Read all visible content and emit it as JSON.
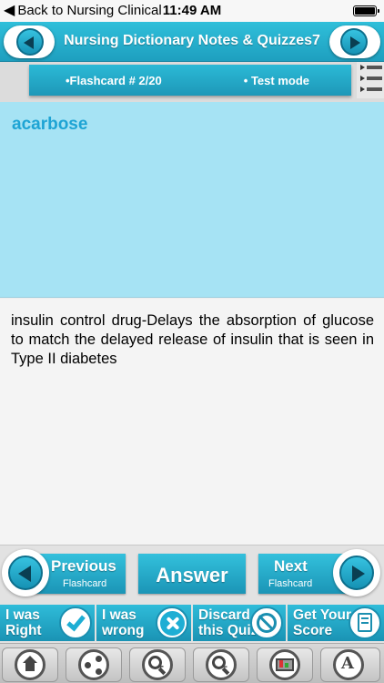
{
  "status_bar": {
    "back_label": "Back to Nursing Clinical",
    "time": "11:49 AM",
    "battery_level": 1.0
  },
  "header": {
    "title": "Nursing Dictionary Notes & Quizzes7"
  },
  "info_strip": {
    "flashcard_label": "•Flashcard #  2/20",
    "mode_label": "• Test mode"
  },
  "card": {
    "question": "acarbose",
    "answer": "insulin control drug-Delays the absorption of glucose to match the delayed release of insulin that is seen in Type II diabetes"
  },
  "navigation": {
    "previous": {
      "title": "Previous",
      "subtitle": "Flashcard"
    },
    "answer": "Answer",
    "next": {
      "title": "Next",
      "subtitle": "Flashcard"
    }
  },
  "actions": {
    "right": {
      "line1": "I was",
      "line2": "Right",
      "icon": "check-icon"
    },
    "wrong": {
      "line1": "I was",
      "line2": "wrong",
      "icon": "x-icon"
    },
    "discard": {
      "line1": "Discard",
      "line2": "this Quiz",
      "icon": "no-entry-icon"
    },
    "score": {
      "line1": "Get Your",
      "line2": "Score",
      "icon": "score-sheet-icon"
    }
  },
  "toolbar": {
    "icons": [
      "home-icon",
      "share-icon",
      "zoom-in-icon",
      "zoom-out-icon",
      "board-icon",
      "font-icon"
    ]
  },
  "colors": {
    "accent": "#1e9fbf",
    "question_bg": "#a6e3f4",
    "question_text": "#1ea4d4"
  }
}
